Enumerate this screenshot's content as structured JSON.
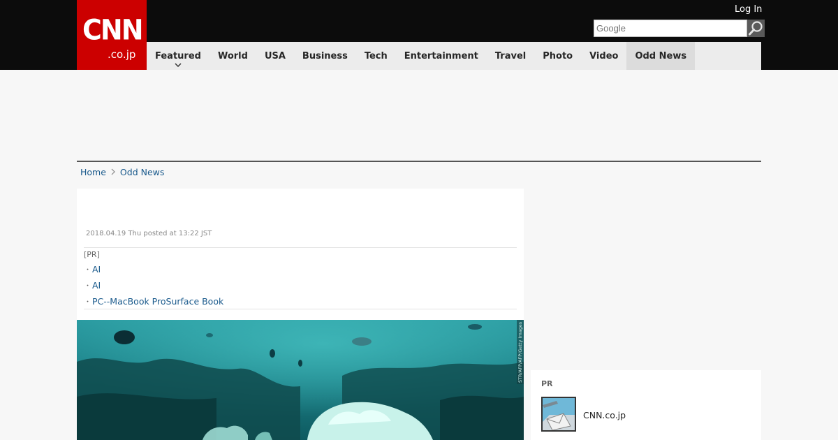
{
  "header": {
    "logo": {
      "line1": "CNN",
      "line2": ".co.jp"
    },
    "login_label": "Log In",
    "search": {
      "placeholder": "Google",
      "value": ""
    }
  },
  "nav": {
    "items": [
      {
        "label": "Featured"
      },
      {
        "label": "World"
      },
      {
        "label": "USA"
      },
      {
        "label": "Business"
      },
      {
        "label": "Tech"
      },
      {
        "label": "Entertainment"
      },
      {
        "label": "Travel"
      },
      {
        "label": "Photo"
      },
      {
        "label": "Video"
      },
      {
        "label": "Odd News"
      }
    ],
    "active": "Odd News"
  },
  "breadcrumb": [
    {
      "label": "Home"
    },
    {
      "label": "Odd News"
    }
  ],
  "article": {
    "posted": "2018.04.19 Thu posted at 13:22 JST",
    "pr_tag": "[PR]",
    "pr_links": [
      {
        "label": "AI"
      },
      {
        "label": "AI"
      },
      {
        "label": "PC--MacBook ProSurface Book"
      }
    ],
    "photo_credit": "STR/AFP/AFP/Getty Images"
  },
  "sidebar": {
    "pr_tag": "PR",
    "pr_item_label": "CNN.co.jp"
  },
  "colors": {
    "brand_red": "#cc0000",
    "header_bg": "#0c0c0c",
    "link_blue": "#1a5a8c"
  },
  "icons": {
    "search": "magnifier-icon",
    "featured_dropdown": "chevron-down-icon",
    "breadcrumb_separator": "chevron-right-icon"
  }
}
